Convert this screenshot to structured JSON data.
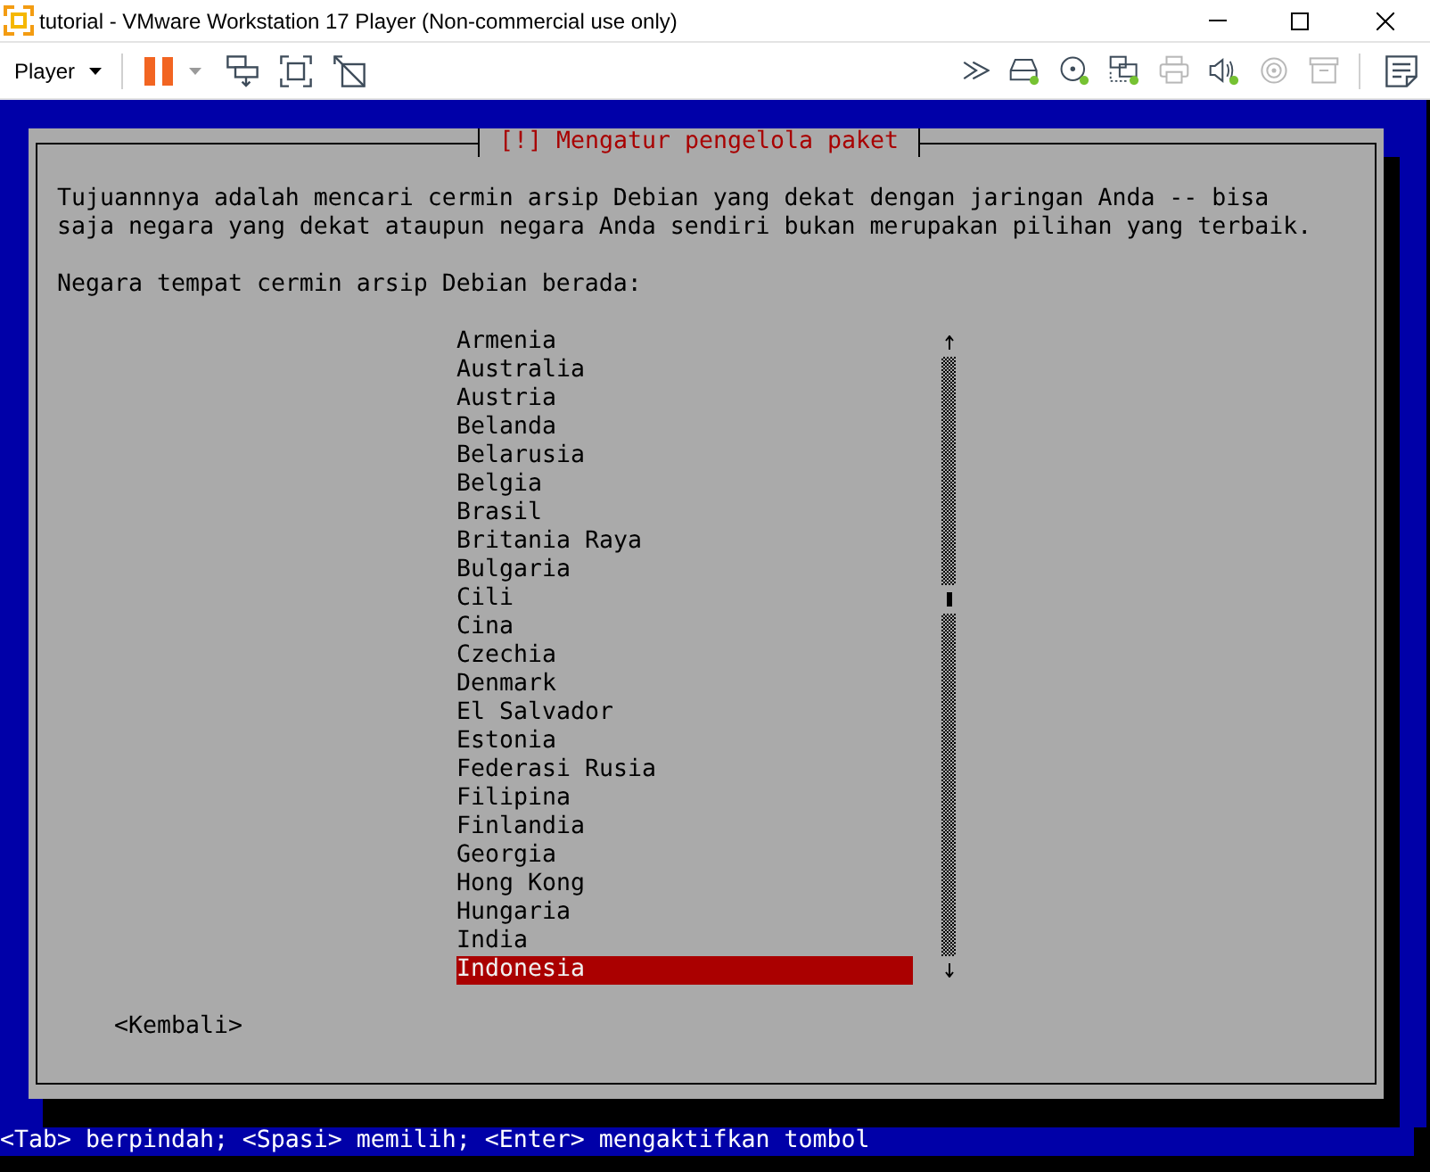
{
  "window": {
    "title": "tutorial - VMware Workstation 17 Player (Non-commercial use only)"
  },
  "toolbar": {
    "menu": "Player",
    "devices": [
      {
        "kind": "disk",
        "connected": true
      },
      {
        "kind": "cd",
        "connected": true
      },
      {
        "kind": "network",
        "connected": true
      },
      {
        "kind": "printer",
        "connected": false
      },
      {
        "kind": "sound",
        "connected": true
      },
      {
        "kind": "rings",
        "connected": false
      },
      {
        "kind": "box",
        "connected": false
      }
    ]
  },
  "dialog": {
    "title": "[!] Mengatur pengelola paket",
    "description": "Tujuannnya adalah mencari cermin arsip Debian yang dekat dengan jaringan Anda -- bisa saja negara yang dekat ataupun negara Anda sendiri bukan merupakan pilihan yang terbaik.",
    "prompt": "Negara tempat cermin arsip Debian berada:",
    "countries": [
      {
        "name": "Armenia",
        "selected": false
      },
      {
        "name": "Australia",
        "selected": false
      },
      {
        "name": "Austria",
        "selected": false
      },
      {
        "name": "Belanda",
        "selected": false
      },
      {
        "name": "Belarusia",
        "selected": false
      },
      {
        "name": "Belgia",
        "selected": false
      },
      {
        "name": "Brasil",
        "selected": false
      },
      {
        "name": "Britania Raya",
        "selected": false
      },
      {
        "name": "Bulgaria",
        "selected": false
      },
      {
        "name": "Cili",
        "selected": false
      },
      {
        "name": "Cina",
        "selected": false
      },
      {
        "name": "Czechia",
        "selected": false
      },
      {
        "name": "Denmark",
        "selected": false
      },
      {
        "name": "El Salvador",
        "selected": false
      },
      {
        "name": "Estonia",
        "selected": false
      },
      {
        "name": "Federasi Rusia",
        "selected": false
      },
      {
        "name": "Filipina",
        "selected": false
      },
      {
        "name": "Finlandia",
        "selected": false
      },
      {
        "name": "Georgia",
        "selected": false
      },
      {
        "name": "Hong Kong",
        "selected": false
      },
      {
        "name": "Hungaria",
        "selected": false
      },
      {
        "name": "India",
        "selected": false
      },
      {
        "name": "Indonesia",
        "selected": true
      }
    ],
    "back_button": "<Kembali>"
  },
  "status_bar": "<Tab> berpindah; <Spasi> memilih; <Enter> mengaktifkan tombol"
}
